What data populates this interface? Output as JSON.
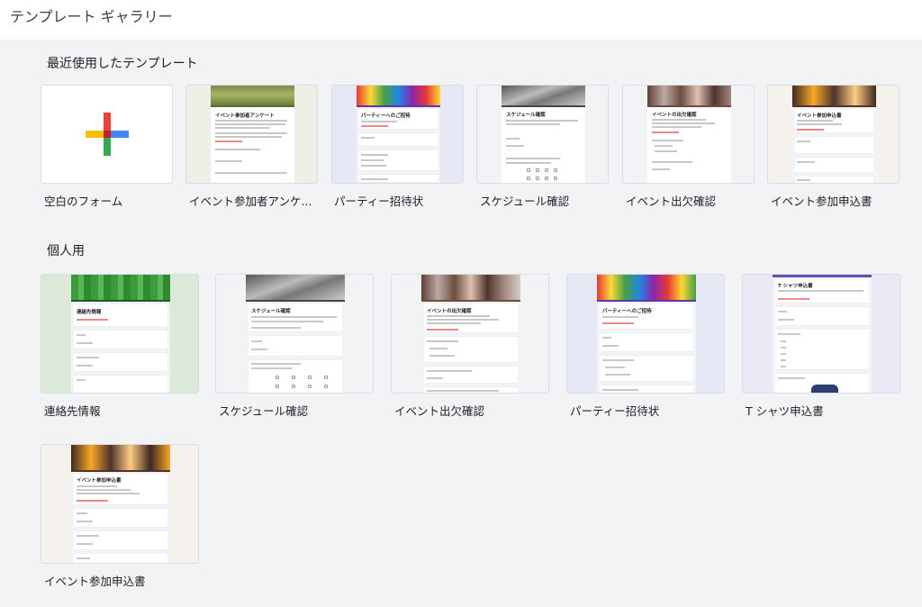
{
  "header": {
    "title": "テンプレート ギャラリー"
  },
  "sections": {
    "recent": {
      "title": "最近使用したテンプレート",
      "cards": [
        {
          "label": "空白のフォーム"
        },
        {
          "label": "イベント参加者アンケ...",
          "thumb_title": "イベント参加者アンケート"
        },
        {
          "label": "パーティー招待状",
          "thumb_title": "パーティーへのご招待"
        },
        {
          "label": "スケジュール確認",
          "thumb_title": "スケジュール確認"
        },
        {
          "label": "イベント出欠確認",
          "thumb_title": "イベントの出欠確認"
        },
        {
          "label": "イベント参加申込書",
          "thumb_title": "イベント参加申込書"
        }
      ]
    },
    "personal": {
      "title": "個人用",
      "cards": [
        {
          "label": "連絡先情報",
          "thumb_title": "連絡先情報"
        },
        {
          "label": "スケジュール確認",
          "thumb_title": "スケジュール確認"
        },
        {
          "label": "イベント出欠確認",
          "thumb_title": "イベントの出欠確認"
        },
        {
          "label": "パーティー招待状",
          "thumb_title": "パーティーへのご招待"
        },
        {
          "label": "T シャツ申込書",
          "thumb_title": "T シャツ申込書"
        },
        {
          "label": "イベント参加申込書",
          "thumb_title": "イベント参加申込書"
        }
      ]
    }
  },
  "colors": {
    "background": "#f1f3f4",
    "google_red": "#ea4335",
    "google_blue": "#4285f4",
    "google_yellow": "#fbbc04",
    "google_green": "#34a853"
  }
}
